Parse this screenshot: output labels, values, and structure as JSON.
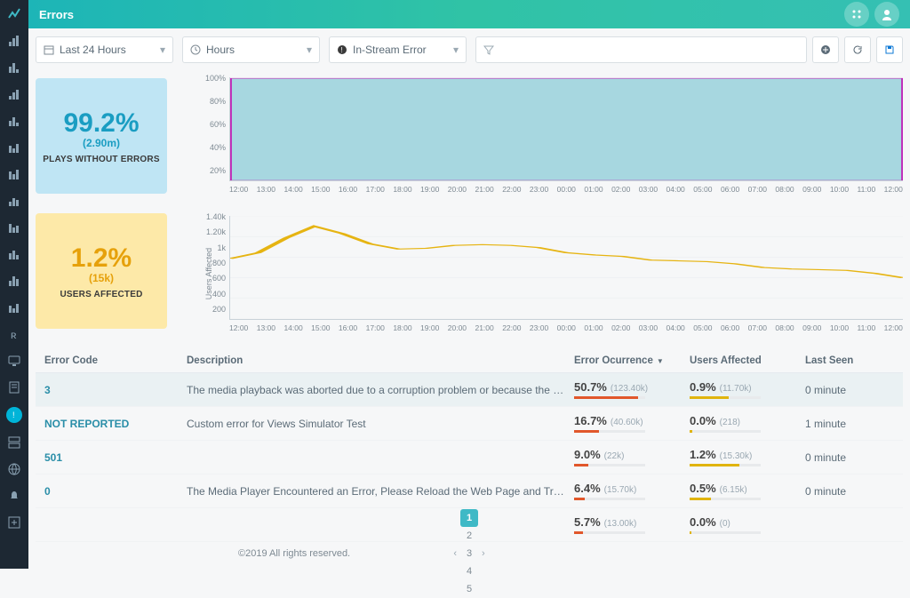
{
  "header": {
    "title": "Errors"
  },
  "filters": {
    "time_range": "Last 24 Hours",
    "granularity": "Hours",
    "error_type": "In-Stream Error",
    "search_placeholder": ""
  },
  "cards": {
    "plays": {
      "value": "99.2%",
      "count": "(2.90m)",
      "label": "PLAYS WITHOUT ERRORS"
    },
    "users": {
      "value": "1.2%",
      "count": "(15k)",
      "label": "USERS AFFECTED"
    }
  },
  "chart_data": [
    {
      "type": "area",
      "id": "plays-without-errors",
      "ylabel": "",
      "y_ticks": [
        "100%",
        "80%",
        "60%",
        "40%",
        "20%"
      ],
      "x_ticks": [
        "12:00",
        "13:00",
        "14:00",
        "15:00",
        "16:00",
        "17:00",
        "18:00",
        "19:00",
        "20:00",
        "21:00",
        "22:00",
        "23:00",
        "00:00",
        "01:00",
        "02:00",
        "03:00",
        "04:00",
        "05:00",
        "06:00",
        "07:00",
        "08:00",
        "09:00",
        "10:00",
        "11:00",
        "12:00"
      ],
      "series": [
        {
          "name": "Plays without errors",
          "values": [
            99,
            99,
            99,
            99,
            99,
            99,
            99,
            99,
            99,
            99,
            99,
            99,
            99,
            99,
            99,
            99,
            99,
            99,
            99,
            99,
            99,
            99,
            99,
            99,
            99
          ]
        }
      ],
      "ylim": [
        0,
        100
      ]
    },
    {
      "type": "line",
      "id": "users-affected",
      "ylabel": "Users Affected",
      "y_ticks": [
        "1.40k",
        "1.20k",
        "1k",
        "800",
        "600",
        "400",
        "200"
      ],
      "x_ticks": [
        "12:00",
        "13:00",
        "14:00",
        "15:00",
        "16:00",
        "17:00",
        "18:00",
        "19:00",
        "20:00",
        "21:00",
        "22:00",
        "23:00",
        "00:00",
        "01:00",
        "02:00",
        "03:00",
        "04:00",
        "05:00",
        "06:00",
        "07:00",
        "08:00",
        "09:00",
        "10:00",
        "11:00",
        "12:00"
      ],
      "series": [
        {
          "name": "Users affected",
          "values": [
            820,
            900,
            1100,
            1260,
            1160,
            1020,
            950,
            960,
            1000,
            1010,
            1000,
            970,
            900,
            870,
            850,
            800,
            790,
            780,
            750,
            700,
            680,
            670,
            660,
            620,
            560
          ]
        }
      ],
      "ylim": [
        0,
        1400
      ]
    }
  ],
  "table": {
    "columns": {
      "code": "Error Code",
      "desc": "Description",
      "occ": "Error Ocurrence",
      "aff": "Users Affected",
      "seen": "Last Seen"
    },
    "sort_icon": "▼",
    "rows": [
      {
        "code": "3",
        "desc": "The media playback was aborted due to a corruption problem or because the media used f...",
        "occ_pct": "50.7%",
        "occ_cnt": "(123.40k)",
        "occ_bar": 90,
        "aff_pct": "0.9%",
        "aff_cnt": "(11.70k)",
        "aff_bar": 55,
        "seen": "0 minute",
        "hl": true
      },
      {
        "code": "NOT REPORTED",
        "desc": "Custom error for Views Simulator Test",
        "occ_pct": "16.7%",
        "occ_cnt": "(40.60k)",
        "occ_bar": 35,
        "aff_pct": "0.0%",
        "aff_cnt": "(218)",
        "aff_bar": 4,
        "seen": "1 minute",
        "hl": false
      },
      {
        "code": "501",
        "desc": "",
        "occ_pct": "9.0%",
        "occ_cnt": "(22k)",
        "occ_bar": 20,
        "aff_pct": "1.2%",
        "aff_cnt": "(15.30k)",
        "aff_bar": 70,
        "seen": "0 minute",
        "hl": false
      },
      {
        "code": "0",
        "desc": "The Media Player Encountered an Error, Please Reload the Web Page and Try Again",
        "occ_pct": "6.4%",
        "occ_cnt": "(15.70k)",
        "occ_bar": 15,
        "aff_pct": "0.5%",
        "aff_cnt": "(6.15k)",
        "aff_bar": 30,
        "seen": "0 minute",
        "hl": false
      },
      {
        "code": "",
        "desc": "",
        "occ_pct": "5.7%",
        "occ_cnt": "(13.00k)",
        "occ_bar": 13,
        "aff_pct": "0.0%",
        "aff_cnt": "(0)",
        "aff_bar": 2,
        "seen": "",
        "hl": false
      }
    ]
  },
  "pagination": {
    "pages": [
      "1",
      "2",
      "3",
      "4",
      "5"
    ],
    "active": "1",
    "prev": "‹",
    "next": "›"
  },
  "footer_copy": "©2019 All rights reserved."
}
